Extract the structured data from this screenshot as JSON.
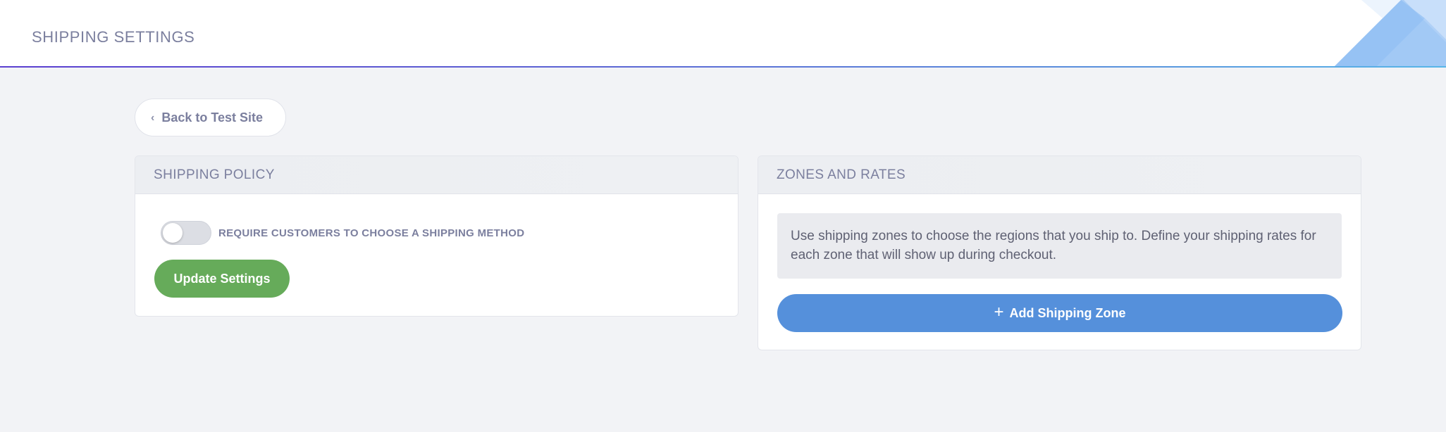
{
  "header": {
    "title": "SHIPPING SETTINGS"
  },
  "back_button": {
    "label": "Back to Test Site",
    "icon": "chevron-left-icon"
  },
  "shipping_policy": {
    "title": "SHIPPING POLICY",
    "toggle_label": "REQUIRE CUSTOMERS TO CHOOSE A SHIPPING METHOD",
    "toggle_on": false,
    "update_button": "Update Settings"
  },
  "zones_and_rates": {
    "title": "ZONES AND RATES",
    "description": "Use shipping zones to choose the regions that you ship to. Define your shipping rates for each zone that will show up during checkout.",
    "add_button": "Add Shipping Zone",
    "add_icon": "plus-icon"
  },
  "colors": {
    "accent_green": "#66ab5a",
    "accent_blue": "#5590db",
    "header_gradient_start": "#5b3fd0",
    "header_gradient_end": "#57b6e8"
  }
}
